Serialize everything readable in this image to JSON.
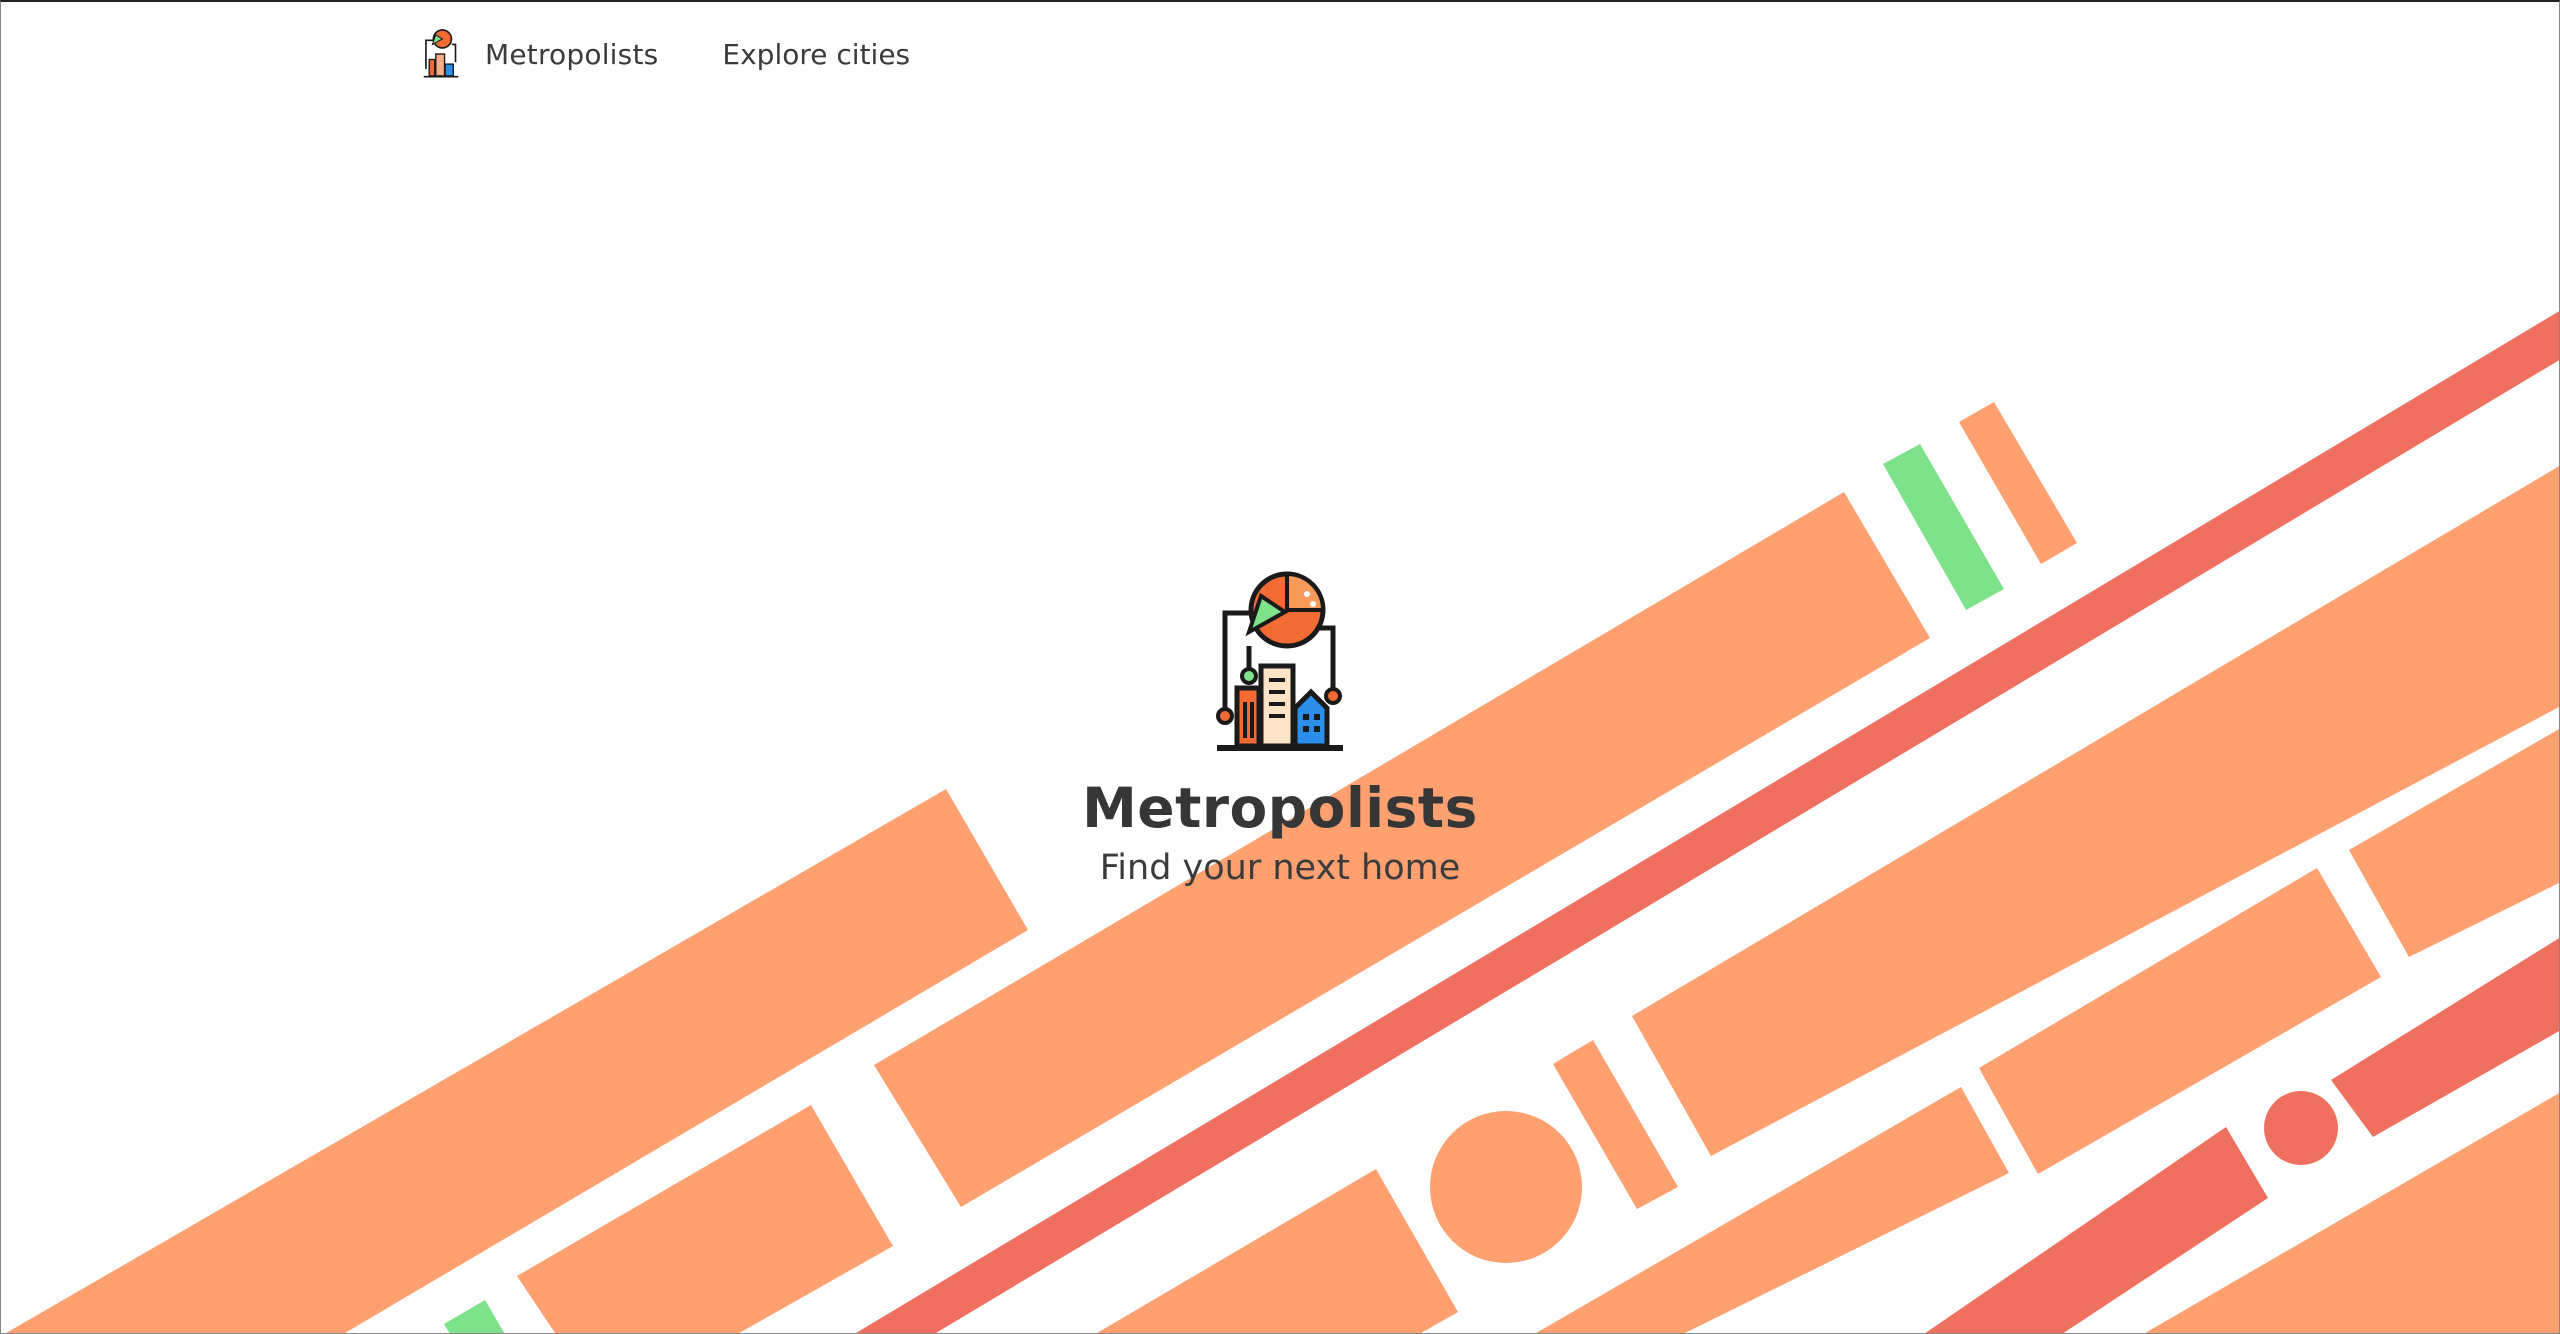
{
  "nav": {
    "brand_label": "Metropolists",
    "links": [
      {
        "label": "Explore cities"
      }
    ]
  },
  "hero": {
    "title": "Metropolists",
    "subtitle": "Find your next home"
  },
  "icons": {
    "brand_logo": "city-chart-logo-icon",
    "hero_logo": "city-chart-logo-icon"
  },
  "colors": {
    "background": "#ffffff",
    "light_orange": "#fea070",
    "salmon": "#f07060",
    "green": "#7de28a",
    "text": "#3b3b3b"
  }
}
